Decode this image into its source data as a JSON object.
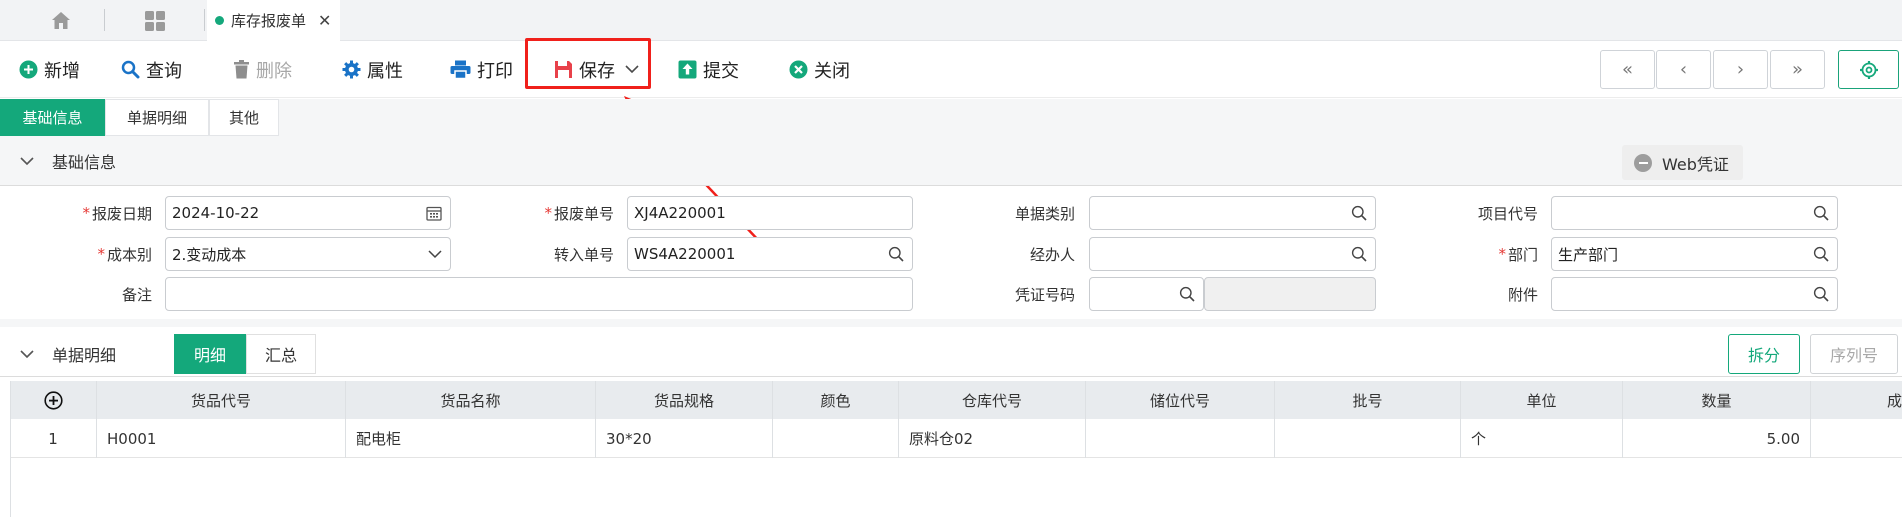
{
  "tabs": {
    "doc_tab_label": "库存报废单"
  },
  "toolbar": {
    "add": "新增",
    "query": "查询",
    "delete": "删除",
    "properties": "属性",
    "print": "打印",
    "save": "保存",
    "submit": "提交",
    "close": "关闭"
  },
  "subtabs": [
    "基础信息",
    "单据明细",
    "其他"
  ],
  "basic_section": {
    "title": "基础信息",
    "web_voucher": "Web凭证"
  },
  "form": {
    "scrap_date_label": "报废日期",
    "scrap_date_value": "2024-10-22",
    "scrap_no_label": "报废单号",
    "scrap_no_value": "XJ4A220001",
    "doc_type_label": "单据类别",
    "doc_type_value": "",
    "project_code_label": "项目代号",
    "project_code_value": "",
    "cost_type_label": "成本别",
    "cost_type_value": "2.变动成本",
    "transfer_no_label": "转入单号",
    "transfer_no_value": "WS4A220001",
    "handler_label": "经办人",
    "handler_value": "",
    "dept_label": "部门",
    "dept_value": "生产部门",
    "remark_label": "备注",
    "remark_value": "",
    "voucher_no_label": "凭证号码",
    "voucher_no_value": "",
    "attachment_label": "附件",
    "attachment_value": ""
  },
  "detail_section": {
    "title": "单据明细",
    "seg_detail": "明细",
    "seg_summary": "汇总",
    "split": "拆分",
    "serial": "序列号"
  },
  "table": {
    "headers": [
      "货品代号",
      "货品名称",
      "货品规格",
      "颜色",
      "仓库代号",
      "储位代号",
      "批号",
      "单位",
      "数量",
      "成"
    ],
    "rows": [
      [
        "1",
        "H0001",
        "配电柜",
        "30*20",
        "",
        "原料仓02",
        "",
        "",
        "个",
        "5.00"
      ]
    ]
  },
  "colors": {
    "accent": "#14a87b",
    "highlight": "#f0201b"
  }
}
